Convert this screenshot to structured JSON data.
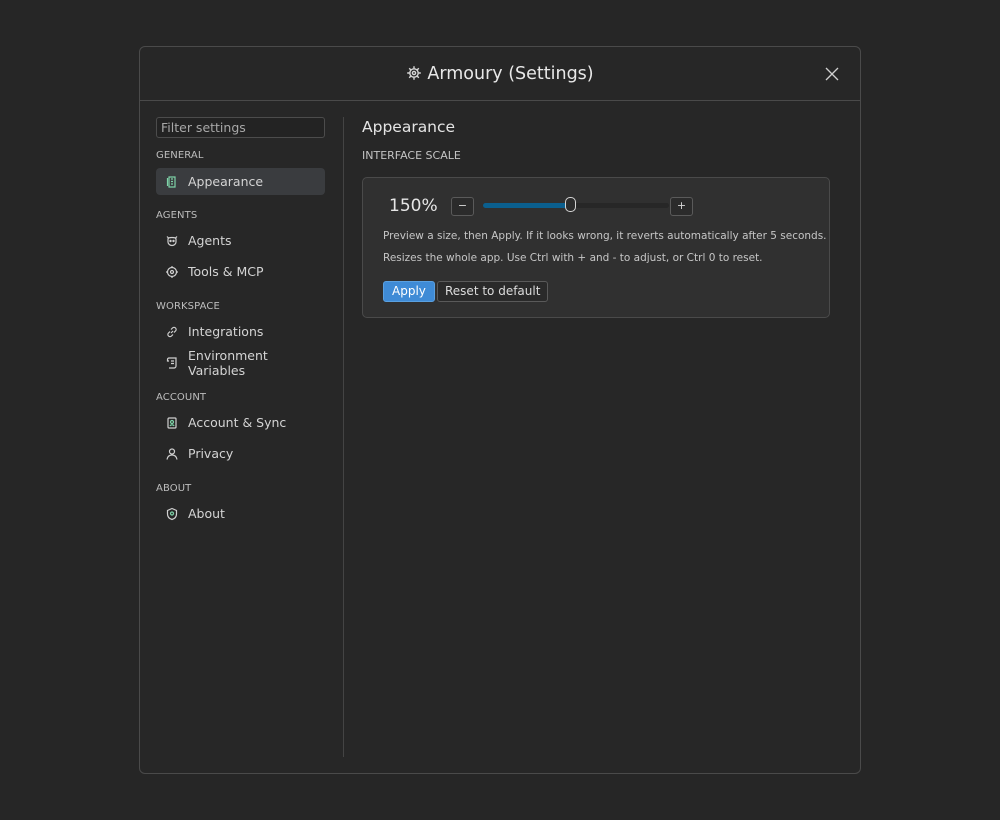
{
  "window": {
    "title": "Armoury (Settings)",
    "title_icon": "gear-icon",
    "close_icon": "close-icon"
  },
  "sidebar": {
    "filter_placeholder": "Filter settings",
    "sections": [
      {
        "label": "GENERAL",
        "items": [
          {
            "label": "Appearance",
            "icon": "appearance-icon",
            "active": true
          }
        ]
      },
      {
        "label": "AGENTS",
        "items": [
          {
            "label": "Agents",
            "icon": "agent-icon"
          },
          {
            "label": "Tools & MCP",
            "icon": "tools-icon"
          }
        ]
      },
      {
        "label": "WORKSPACE",
        "items": [
          {
            "label": "Integrations",
            "icon": "link-icon"
          },
          {
            "label": "Environment Variables",
            "icon": "scroll-icon"
          }
        ]
      },
      {
        "label": "ACCOUNT",
        "items": [
          {
            "label": "Account & Sync",
            "icon": "account-sync-icon"
          },
          {
            "label": "Privacy",
            "icon": "person-icon"
          }
        ]
      },
      {
        "label": "ABOUT",
        "items": [
          {
            "label": "About",
            "icon": "shield-icon"
          }
        ]
      }
    ]
  },
  "main": {
    "title": "Appearance",
    "scale_section_label": "INTERFACE SCALE",
    "scale_value": "150%",
    "slider_fraction": 0.47,
    "decrement_label": "−",
    "increment_label": "+",
    "help_line1": "Preview a size, then Apply. If it looks wrong, it reverts automatically after 5 seconds.",
    "help_line2": "Resizes the whole app. Use Ctrl with + and - to adjust, or Ctrl 0 to reset.",
    "apply_label": "Apply",
    "reset_label": "Reset to default"
  },
  "colors": {
    "accent": "#3f8bd6",
    "slider_fill": "#0b5f8e",
    "icon_green": "#7ed3a8",
    "background": "#262626"
  }
}
